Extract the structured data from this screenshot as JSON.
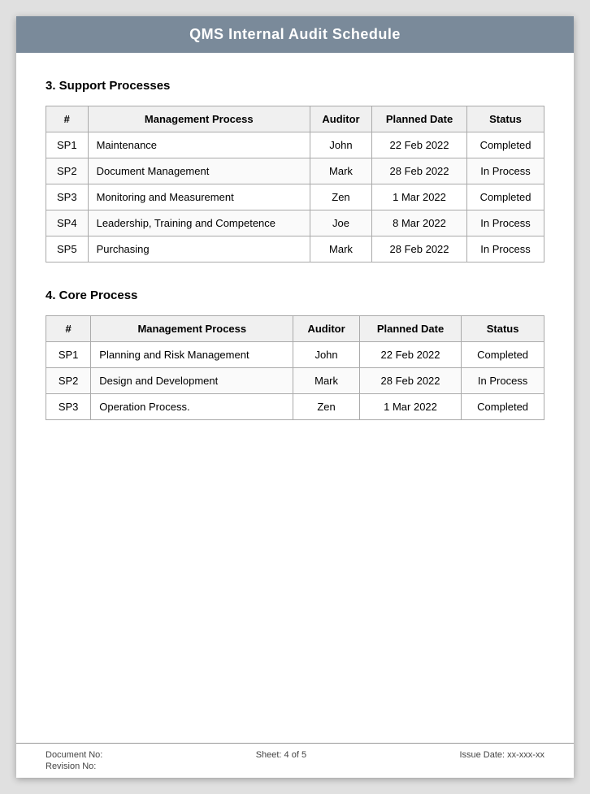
{
  "header": {
    "title": "QMS Internal Audit Schedule"
  },
  "section3": {
    "title": "3.  Support Processes",
    "table": {
      "columns": [
        "#",
        "Management Process",
        "Auditor",
        "Planned Date",
        "Status"
      ],
      "rows": [
        {
          "num": "SP1",
          "process": "Maintenance",
          "auditor": "John",
          "date": "22 Feb 2022",
          "status": "Completed"
        },
        {
          "num": "SP2",
          "process": "Document Management",
          "auditor": "Mark",
          "date": "28 Feb 2022",
          "status": "In Process"
        },
        {
          "num": "SP3",
          "process": "Monitoring and Measurement",
          "auditor": "Zen",
          "date": "1 Mar 2022",
          "status": "Completed"
        },
        {
          "num": "SP4",
          "process": "Leadership, Training and Competence",
          "auditor": "Joe",
          "date": "8 Mar 2022",
          "status": "In Process"
        },
        {
          "num": "SP5",
          "process": "Purchasing",
          "auditor": "Mark",
          "date": "28 Feb 2022",
          "status": "In Process"
        }
      ]
    }
  },
  "section4": {
    "title": "4.  Core Process",
    "table": {
      "columns": [
        "#",
        "Management Process",
        "Auditor",
        "Planned Date",
        "Status"
      ],
      "rows": [
        {
          "num": "SP1",
          "process": "Planning and Risk Management",
          "auditor": "John",
          "date": "22 Feb 2022",
          "status": "Completed"
        },
        {
          "num": "SP2",
          "process": "Design and Development",
          "auditor": "Mark",
          "date": "28 Feb 2022",
          "status": "In Process"
        },
        {
          "num": "SP3",
          "process": "Operation Process.",
          "auditor": "Zen",
          "date": "1 Mar 2022",
          "status": "Completed"
        }
      ]
    }
  },
  "footer": {
    "document_no_label": "Document No:",
    "revision_no_label": "Revision No:",
    "sheet_label": "Sheet: 4 of 5",
    "issue_date_label": "Issue Date: xx-xxx-xx"
  }
}
